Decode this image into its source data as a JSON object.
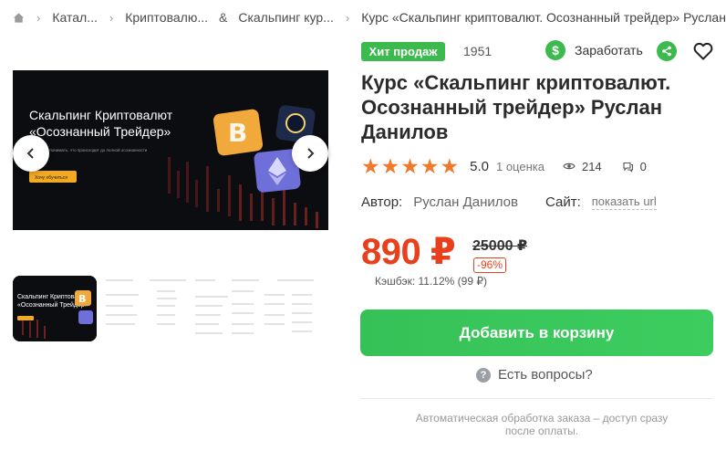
{
  "breadcrumb": {
    "items": [
      "Катал...",
      "Криптовалю...",
      "Скальпинг кур...",
      "Курс «Скальпинг криптовалют. Осознанный трейдер» Руслан ..."
    ],
    "ampersand": "&"
  },
  "gallery": {
    "slide_title_line1": "Скальпинг Криптовалют",
    "slide_title_line2": "«Осознанный Трейдер»",
    "slide_caption": "научитесь понимать, что происходит до полной осознанности",
    "slide_button": "Хочу обучиться",
    "thumb_title_line1": "Скальпинг Криптовалют",
    "thumb_title_line2": "«Осознанный Трейдер»"
  },
  "badges": {
    "hit": "Хит продаж",
    "sku": "1951"
  },
  "actions": {
    "earn_label": "Заработать",
    "earn_symbol": "$"
  },
  "product": {
    "title": "Курс «Скальпинг криптовалют. Осознанный трейдер» Руслан Данилов",
    "score": "5.0",
    "reviews": "1 оценка",
    "views": "214",
    "comments": "0",
    "author_label": "Автор:",
    "author": "Руслан Данилов",
    "site_label": "Сайт:",
    "site_link": "показать url"
  },
  "pricing": {
    "price": "890 ₽",
    "old_price": "25000 ₽",
    "discount": "-96%",
    "cashback": "Кэшбэк: 11.12% (99 ₽)"
  },
  "cart": {
    "button": "Добавить в корзину"
  },
  "help": {
    "questions": "Есть вопросы?",
    "q_mark": "?"
  },
  "footer": {
    "note": "Автоматическая обработка заказа – доступ сразу после оплаты."
  },
  "colors": {
    "accent_green": "#3dba4e",
    "price_red": "#e8401c",
    "star_orange": "#f07a2c"
  },
  "icons": [
    "home-icon",
    "chevron-right-icon",
    "chevron-left-icon",
    "share-icon",
    "heart-icon",
    "star-icon",
    "eye-icon",
    "comment-icon",
    "question-icon",
    "bitcoin-icon",
    "ethereum-icon"
  ]
}
